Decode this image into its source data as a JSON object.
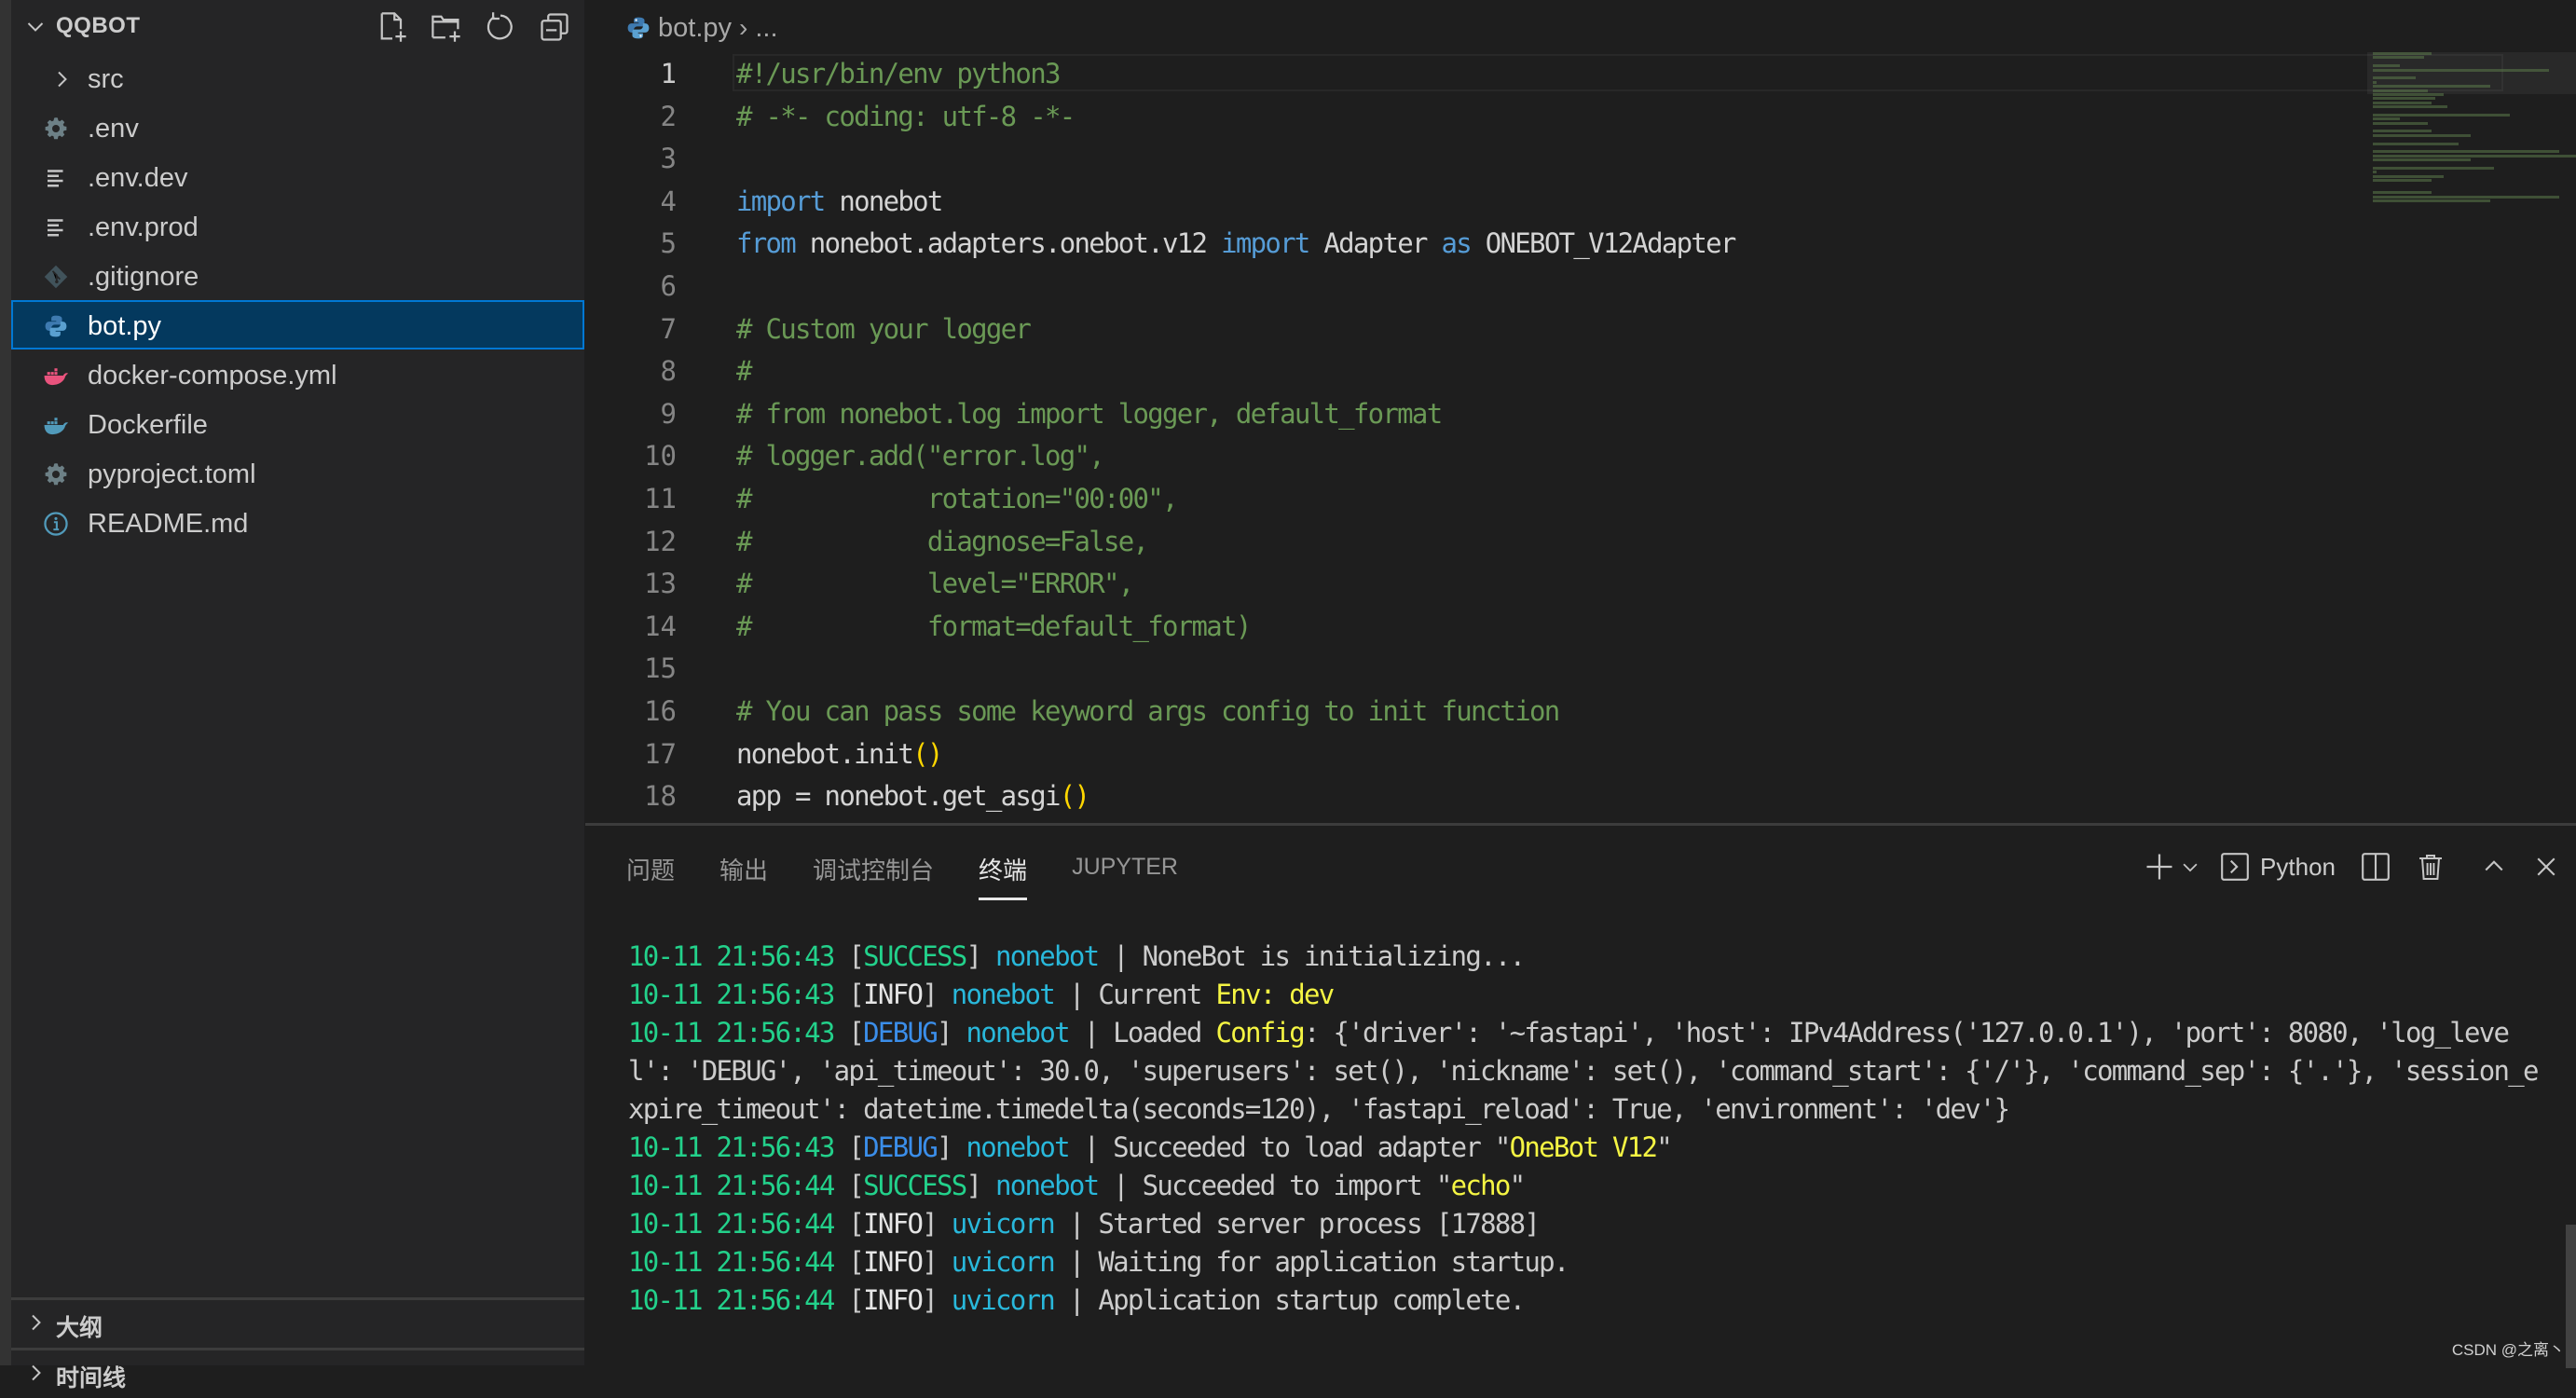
{
  "sidebar": {
    "title": "QQBOT",
    "actions": [
      {
        "name": "new-file",
        "icon": "new-file-icon"
      },
      {
        "name": "new-folder",
        "icon": "new-folder-icon"
      },
      {
        "name": "refresh",
        "icon": "refresh-icon"
      },
      {
        "name": "collapse-all",
        "icon": "collapse-all-icon"
      }
    ],
    "items": [
      {
        "label": "src",
        "type": "folder",
        "icon": "chevron-right-icon"
      },
      {
        "label": ".env",
        "type": "file",
        "icon": "gear-icon"
      },
      {
        "label": ".env.dev",
        "type": "file",
        "icon": "text-lines-icon"
      },
      {
        "label": ".env.prod",
        "type": "file",
        "icon": "text-lines-icon"
      },
      {
        "label": ".gitignore",
        "type": "file",
        "icon": "git-icon"
      },
      {
        "label": "bot.py",
        "type": "file",
        "icon": "python-icon",
        "selected": true
      },
      {
        "label": "docker-compose.yml",
        "type": "file",
        "icon": "docker-pink-icon"
      },
      {
        "label": "Dockerfile",
        "type": "file",
        "icon": "docker-blue-icon"
      },
      {
        "label": "pyproject.toml",
        "type": "file",
        "icon": "gear-icon"
      },
      {
        "label": "README.md",
        "type": "file",
        "icon": "info-icon"
      }
    ],
    "sections": [
      {
        "label": "大纲"
      },
      {
        "label": "时间线"
      }
    ]
  },
  "editor": {
    "breadcrumb": {
      "file": "bot.py",
      "separator": "›",
      "more": "..."
    },
    "current_line": 1,
    "lines": [
      {
        "n": "1",
        "tokens": [
          {
            "t": "#!/usr/bin/env python3",
            "c": "comment"
          }
        ]
      },
      {
        "n": "2",
        "tokens": [
          {
            "t": "# -*- coding: utf-8 -*-",
            "c": "comment"
          }
        ]
      },
      {
        "n": "3",
        "tokens": []
      },
      {
        "n": "4",
        "tokens": [
          {
            "t": "import",
            "c": "kw"
          },
          {
            "t": " nonebot",
            "c": "plain"
          }
        ]
      },
      {
        "n": "5",
        "tokens": [
          {
            "t": "from",
            "c": "kw"
          },
          {
            "t": " nonebot.adapters.onebot.v12 ",
            "c": "plain"
          },
          {
            "t": "import",
            "c": "kw"
          },
          {
            "t": " Adapter ",
            "c": "plain"
          },
          {
            "t": "as",
            "c": "kw"
          },
          {
            "t": " ONEBOT_V12Adapter",
            "c": "plain"
          }
        ]
      },
      {
        "n": "6",
        "tokens": []
      },
      {
        "n": "7",
        "tokens": [
          {
            "t": "# Custom your logger",
            "c": "comment"
          }
        ]
      },
      {
        "n": "8",
        "tokens": [
          {
            "t": "#",
            "c": "comment"
          }
        ]
      },
      {
        "n": "9",
        "tokens": [
          {
            "t": "# from nonebot.log import logger, default_format",
            "c": "comment"
          }
        ]
      },
      {
        "n": "10",
        "tokens": [
          {
            "t": "# logger.add(\"error.log\",",
            "c": "comment"
          }
        ]
      },
      {
        "n": "11",
        "tokens": [
          {
            "t": "#            rotation=\"00:00\",",
            "c": "comment"
          }
        ]
      },
      {
        "n": "12",
        "tokens": [
          {
            "t": "#            diagnose=False,",
            "c": "comment"
          }
        ]
      },
      {
        "n": "13",
        "tokens": [
          {
            "t": "#            level=\"ERROR\",",
            "c": "comment"
          }
        ]
      },
      {
        "n": "14",
        "tokens": [
          {
            "t": "#            format=default_format)",
            "c": "comment"
          }
        ]
      },
      {
        "n": "15",
        "tokens": []
      },
      {
        "n": "16",
        "tokens": [
          {
            "t": "# You can pass some keyword args config to init function",
            "c": "comment"
          }
        ]
      },
      {
        "n": "17",
        "tokens": [
          {
            "t": "nonebot.init",
            "c": "plain"
          },
          {
            "t": "()",
            "c": "paren"
          }
        ]
      },
      {
        "n": "18",
        "tokens": [
          {
            "t": "app = nonebot.get_asgi",
            "c": "plain"
          },
          {
            "t": "()",
            "c": "paren"
          }
        ]
      }
    ]
  },
  "panel": {
    "tabs": [
      {
        "label": "问题",
        "active": false
      },
      {
        "label": "输出",
        "active": false
      },
      {
        "label": "调试控制台",
        "active": false
      },
      {
        "label": "终端",
        "active": true
      },
      {
        "label": "JUPYTER",
        "active": false
      }
    ],
    "actions": {
      "new_terminal_icon": "plus-icon",
      "dropdown_icon": "chevron-down-icon",
      "shell_icon": "terminal-icon",
      "shell_label": "Python",
      "split_icon": "split-icon",
      "kill_icon": "trash-icon",
      "maximize_icon": "chevron-up-icon",
      "close_icon": "close-icon"
    },
    "terminal": [
      {
        "time": "10-11 21:56:43",
        "level": "SUCCESS",
        "source": "nonebot",
        "parts": [
          {
            "t": "NoneBot is initializing...",
            "c": "plain"
          }
        ]
      },
      {
        "time": "10-11 21:56:43",
        "level": "INFO",
        "source": "nonebot",
        "parts": [
          {
            "t": "Current ",
            "c": "plain"
          },
          {
            "t": "Env: dev",
            "c": "hl"
          }
        ]
      },
      {
        "time": "10-11 21:56:43",
        "level": "DEBUG",
        "source": "nonebot",
        "parts": [
          {
            "t": "Loaded ",
            "c": "plain"
          },
          {
            "t": "Config",
            "c": "hl"
          },
          {
            "t": ": {'driver': '~fastapi', 'host': IPv4Address('127.0.0.1'), 'port': 8080, 'log_level': 'DEBUG', 'api_timeout': 30.0, 'superusers': set(), 'nickname': set(), 'command_start': {'/'}, 'command_sep': {'.'}, 'session_expire_timeout': datetime.timedelta(seconds=120), 'fastapi_reload': True, 'environment': 'dev'}",
            "c": "plain"
          }
        ]
      },
      {
        "time": "10-11 21:56:43",
        "level": "DEBUG",
        "source": "nonebot",
        "parts": [
          {
            "t": "Succeeded to load adapter \"",
            "c": "plain"
          },
          {
            "t": "OneBot V12",
            "c": "hl"
          },
          {
            "t": "\"",
            "c": "plain"
          }
        ]
      },
      {
        "time": "10-11 21:56:44",
        "level": "SUCCESS",
        "source": "nonebot",
        "parts": [
          {
            "t": "Succeeded to import \"",
            "c": "plain"
          },
          {
            "t": "echo",
            "c": "hl"
          },
          {
            "t": "\"",
            "c": "plain"
          }
        ]
      },
      {
        "time": "10-11 21:56:44",
        "level": "INFO",
        "source": "uvicorn",
        "parts": [
          {
            "t": "Started server process [17888]",
            "c": "plain"
          }
        ]
      },
      {
        "time": "10-11 21:56:44",
        "level": "INFO",
        "source": "uvicorn",
        "parts": [
          {
            "t": "Waiting for application startup.",
            "c": "plain"
          }
        ]
      },
      {
        "time": "10-11 21:56:44",
        "level": "INFO",
        "source": "uvicorn",
        "parts": [
          {
            "t": "Application startup complete.",
            "c": "plain"
          }
        ]
      }
    ]
  },
  "watermark": "CSDN @之离丶",
  "colors": {
    "selection_bg": "#04395e",
    "selection_border": "#0078d4",
    "comment": "#6a9955",
    "keyword": "#569cd6",
    "log_time": "#23d18b",
    "log_debug": "#3b8eea",
    "log_source": "#29b8db",
    "log_highlight": "#f5f543"
  }
}
